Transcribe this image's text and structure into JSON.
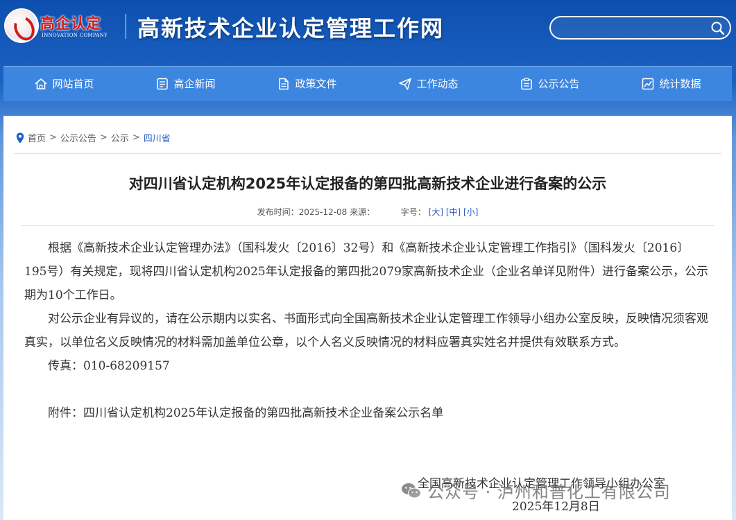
{
  "header": {
    "logo_cn": "高企认定",
    "logo_en": "INNOVATION COMPANY",
    "site_title": "高新技术企业认定管理工作网",
    "search_placeholder": ""
  },
  "nav": {
    "items": [
      {
        "label": "网站首页",
        "icon": "home-icon"
      },
      {
        "label": "高企新闻",
        "icon": "news-icon"
      },
      {
        "label": "政策文件",
        "icon": "document-icon"
      },
      {
        "label": "工作动态",
        "icon": "paper-plane-icon"
      },
      {
        "label": "公示公告",
        "icon": "announcement-icon"
      },
      {
        "label": "统计数据",
        "icon": "chart-icon"
      }
    ]
  },
  "breadcrumb": {
    "items": [
      "首页",
      "公示公告",
      "公示",
      "四川省"
    ],
    "separator": ">"
  },
  "article": {
    "title": "对四川省认定机构2025年认定报备的第四批高新技术企业进行备案的公示",
    "meta_published": "发布时间：2025-12-08 来源：",
    "meta_fontsize_label": "字号：",
    "font_sizes": [
      "[大]",
      "[中]",
      "[小]"
    ],
    "paragraphs": [
      "根据《高新技术企业认定管理办法》（国科发火〔2016〕32号）和《高新技术企业认定管理工作指引》（国科发火〔2016〕195号）有关规定，现将四川省认定机构2025年认定报备的第四批2079家高新技术企业（企业名单详见附件）进行备案公示，公示期为10个工作日。",
      "对公示企业有异议的，请在公示期内以实名、书面形式向全国高新技术企业认定管理工作领导小组办公室反映，反映情况须客观真实，以单位名义反映情况的材料需加盖单位公章，以个人名义反映情况的材料应署真实姓名并提供有效联系方式。",
      "传真：010-68209157"
    ],
    "attachment": "附件：四川省认定机构2025年认定报备的第四批高新技术企业备案公示名单",
    "signature": "全国高新技术企业认定管理工作领导小组办公室",
    "date": "2025年12月8日"
  },
  "watermark": {
    "text": "公众号 · 泸州和普化工有限公司"
  },
  "colors": {
    "nav_bg": "#3d86e0",
    "header_bg": "#0e4fae",
    "link": "#2a5bbf",
    "logo_red": "#d11c1c"
  }
}
